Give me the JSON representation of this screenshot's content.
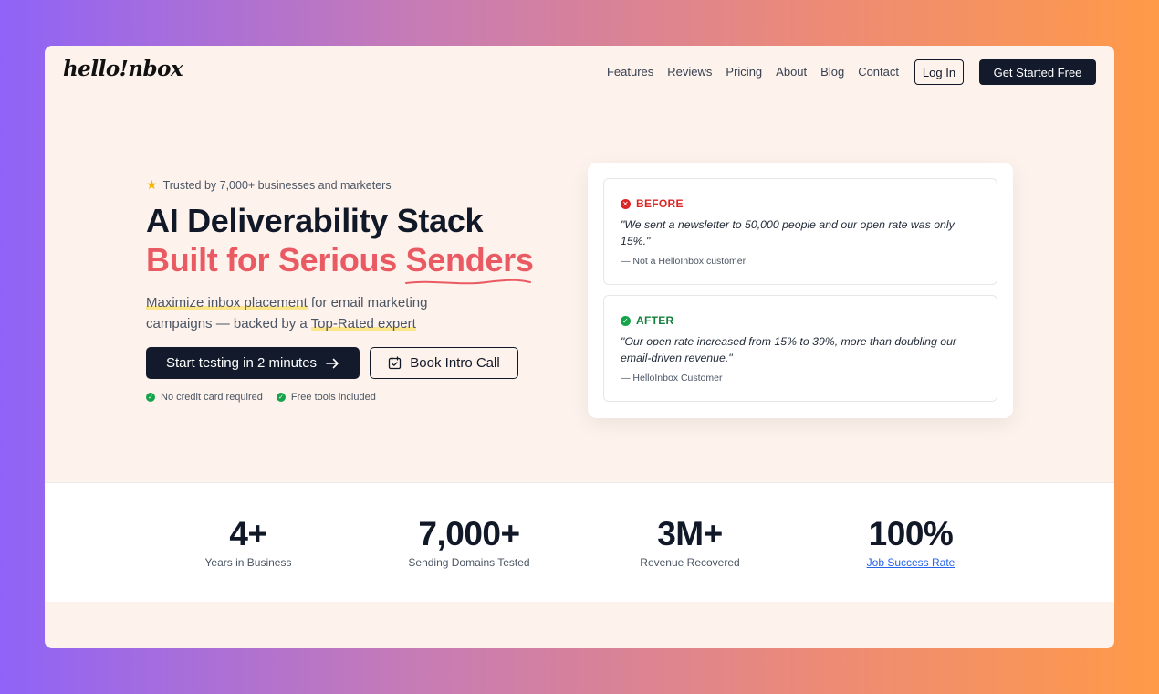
{
  "nav": {
    "logo": "hello!nbox",
    "links": [
      "Features",
      "Reviews",
      "Pricing",
      "About",
      "Blog",
      "Contact"
    ],
    "login_label": "Log In",
    "cta_label": "Get Started Free"
  },
  "hero": {
    "trusted": "Trusted by 7,000+ businesses and marketers",
    "title_line1": "AI Deliverability Stack",
    "title_line2_prefix": "Built for Serious ",
    "title_line2_highlight": "Senders",
    "sub_part1": "Maximize inbox placement",
    "sub_part2": " for email marketing campaigns — backed by a ",
    "sub_part3": "Top-Rated expert",
    "primary_cta": "Start testing in 2 minutes",
    "secondary_cta": "Book Intro Call",
    "check1": "No credit card required",
    "check2": "Free tools included"
  },
  "testimonials": {
    "before": {
      "label": "BEFORE",
      "quote": "\"We sent a newsletter to 50,000 people and our open rate was only 15%.\"",
      "author": "— Not a HelloInbox customer"
    },
    "after": {
      "label": "AFTER",
      "quote": "\"Our open rate increased from 15% to 39%, more than doubling our email-driven revenue.\"",
      "author": "— HelloInbox Customer"
    }
  },
  "stats": [
    {
      "value": "4+",
      "label": "Years in Business"
    },
    {
      "value": "7,000+",
      "label": "Sending Domains Tested"
    },
    {
      "value": "3M+",
      "label": "Revenue Recovered"
    },
    {
      "value": "100%",
      "label": "Job Success Rate"
    }
  ],
  "colors": {
    "accent_red": "#ea5a63",
    "dark": "#121a2b",
    "success": "#16a34a",
    "error": "#dc2626",
    "link": "#2563eb"
  }
}
